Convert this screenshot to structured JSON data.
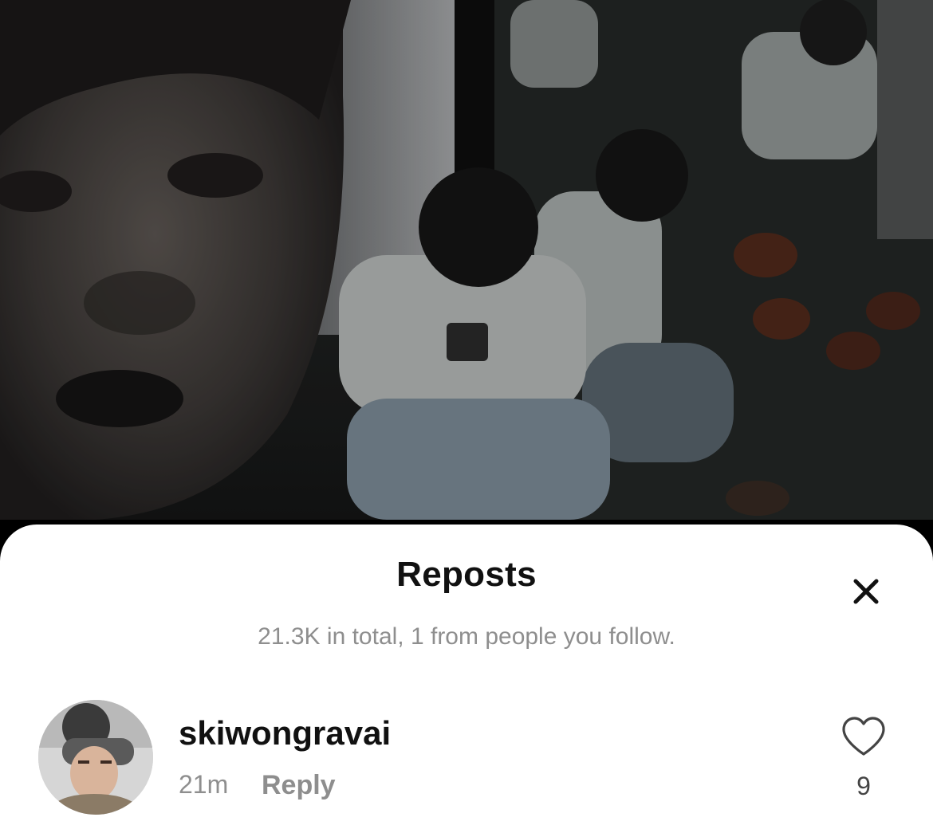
{
  "sheet": {
    "title": "Reposts",
    "subtitle": "21.3K in total, 1 from people you follow.",
    "close_icon": "close-icon"
  },
  "repost_list": [
    {
      "username": "skiwongravai",
      "time": "21m",
      "reply_label": "Reply",
      "like_count": "9",
      "like_icon": "heart-outline-icon"
    }
  ],
  "colors": {
    "sheet_bg": "#ffffff",
    "title_text": "#111111",
    "secondary_text": "#8e8e8e"
  }
}
